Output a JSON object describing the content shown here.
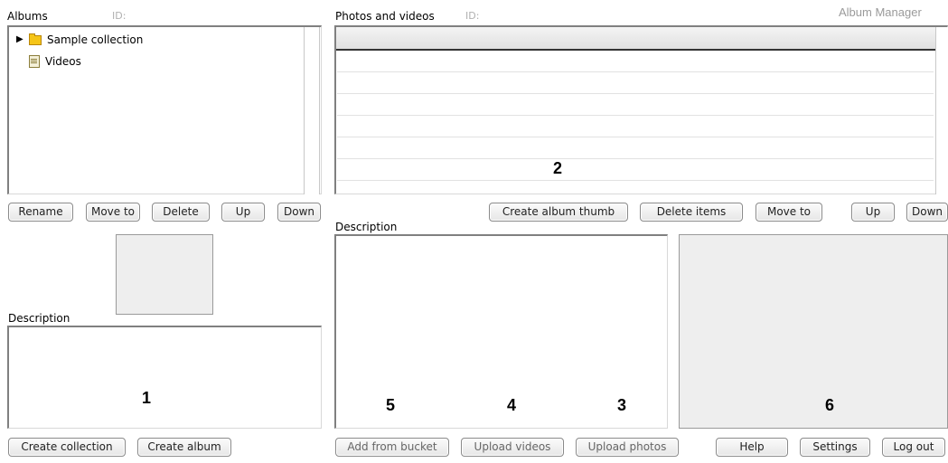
{
  "albums": {
    "title": "Albums",
    "id_label": "ID:",
    "tree": [
      {
        "label": "Sample collection",
        "type": "collection"
      },
      {
        "label": "Videos",
        "type": "album"
      }
    ],
    "buttons": {
      "rename": "Rename",
      "move_to": "Move to",
      "delete": "Delete",
      "up": "Up",
      "down": "Down"
    },
    "description_label": "Description",
    "marker": "1",
    "bottom_buttons": {
      "create_collection": "Create collection",
      "create_album": "Create album"
    }
  },
  "photos": {
    "title": "Photos and videos",
    "id_label": "ID:",
    "app_title": "Album Manager",
    "marker": "2",
    "buttons": {
      "create_album_thumb": "Create album thumb",
      "delete_items": "Delete items",
      "move_to": "Move to",
      "up": "Up",
      "down": "Down"
    },
    "description_label": "Description",
    "markers": {
      "upload_photos": "3",
      "upload_videos": "4",
      "add_from_bucket": "5",
      "preview": "6"
    },
    "bottom_buttons": {
      "add_from_bucket": "Add from bucket",
      "upload_videos": "Upload videos",
      "upload_photos": "Upload photos"
    }
  },
  "footer": {
    "help": "Help",
    "settings": "Settings",
    "log_out": "Log out"
  }
}
